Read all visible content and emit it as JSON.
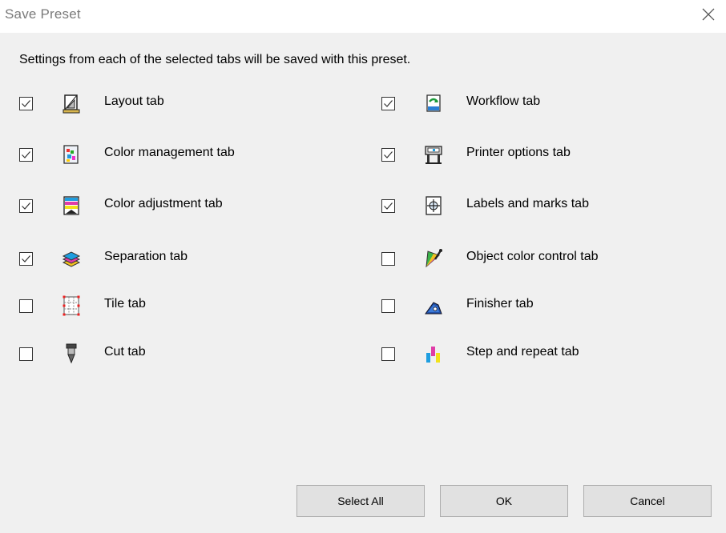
{
  "window": {
    "title": "Save Preset"
  },
  "description": "Settings from each of the selected tabs will be saved with this preset.",
  "options": [
    {
      "label": "Layout tab",
      "checked": true,
      "icon": "layout-icon"
    },
    {
      "label": "Color management tab",
      "checked": true,
      "icon": "color-management-icon"
    },
    {
      "label": "Color adjustment tab",
      "checked": true,
      "icon": "color-adjustment-icon"
    },
    {
      "label": "Separation tab",
      "checked": true,
      "icon": "separation-icon"
    },
    {
      "label": "Tile tab",
      "checked": false,
      "icon": "tile-icon"
    },
    {
      "label": "Cut tab",
      "checked": false,
      "icon": "cut-icon"
    },
    {
      "label": "Workflow tab",
      "checked": true,
      "icon": "workflow-icon"
    },
    {
      "label": "Printer options tab",
      "checked": true,
      "icon": "printer-icon"
    },
    {
      "label": "Labels and marks tab",
      "checked": true,
      "icon": "labels-marks-icon"
    },
    {
      "label": "Object color control tab",
      "checked": false,
      "icon": "object-color-icon"
    },
    {
      "label": "Finisher tab",
      "checked": false,
      "icon": "finisher-icon"
    },
    {
      "label": "Step and repeat tab",
      "checked": false,
      "icon": "step-repeat-icon"
    }
  ],
  "buttons": {
    "select_all": "Select All",
    "ok": "OK",
    "cancel": "Cancel"
  }
}
